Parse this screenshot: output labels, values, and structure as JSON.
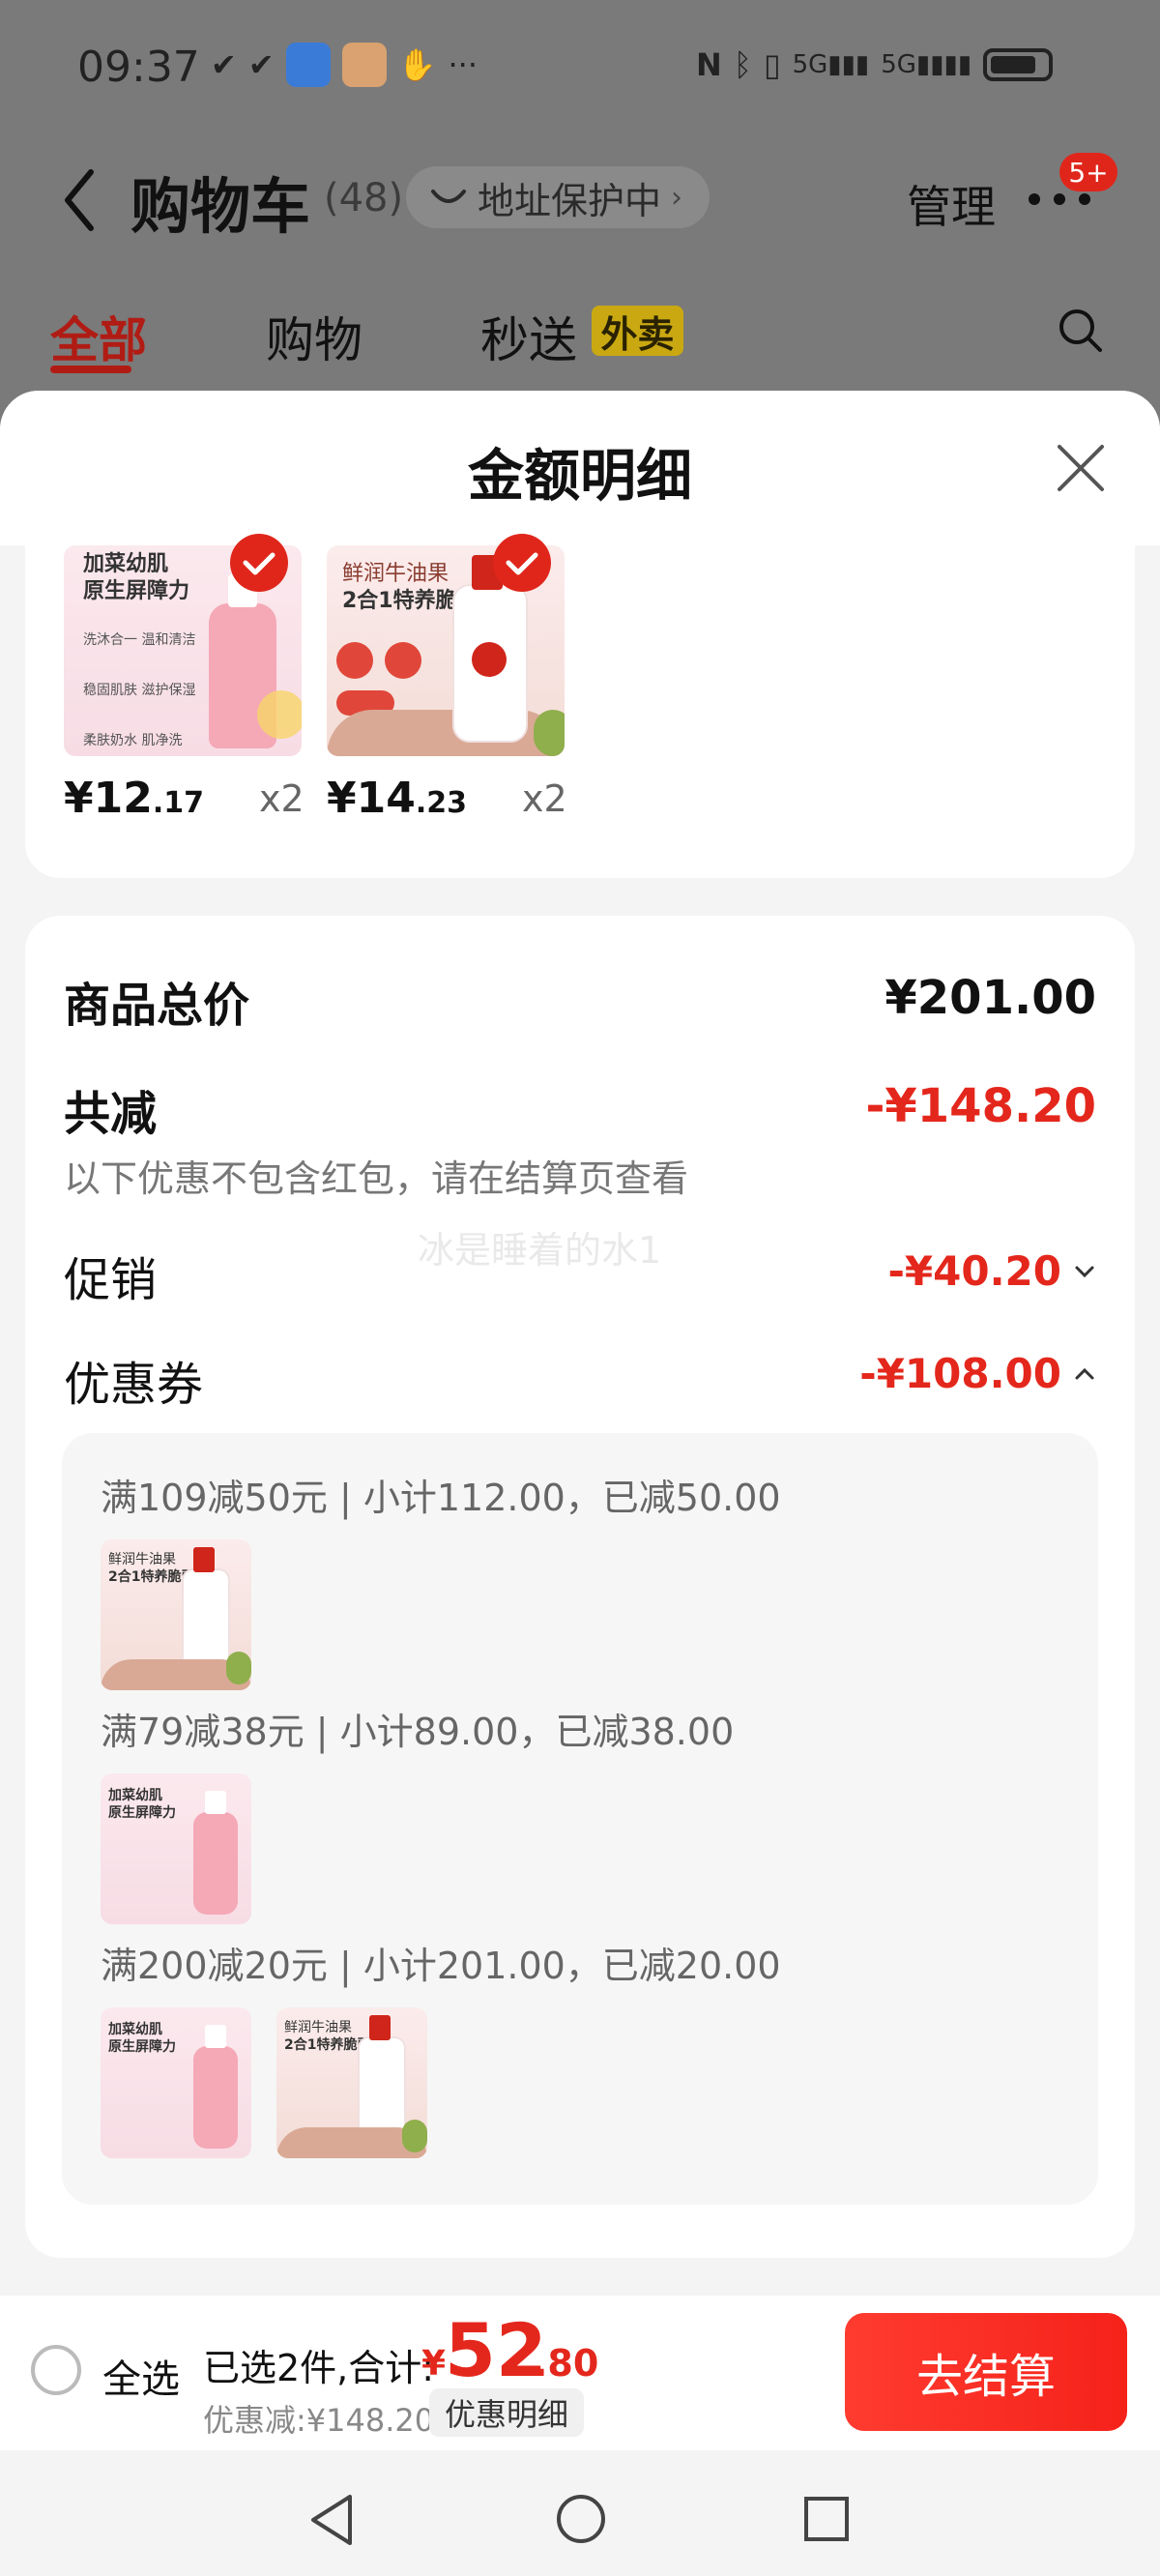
{
  "status": {
    "time": "09:37"
  },
  "header": {
    "title": "购物车",
    "count": "(48)",
    "address": "地址保护中",
    "manage": "管理",
    "more_badge": "5+"
  },
  "tabs": [
    {
      "label": "全部"
    },
    {
      "label": "购物"
    },
    {
      "label": "秒送"
    }
  ],
  "tab_badge": "外卖",
  "sheet": {
    "title": "金额明细"
  },
  "items": [
    {
      "currency": "¥",
      "price_int": "12",
      "price_dec": ".17",
      "qty": "x2",
      "thumb_lines": [
        "加菜幼肌",
        "原生屏障力",
        "洗沐合一 温和清洁",
        "稳固肌肤 滋护保湿",
        "柔肤奶水 肌净洗"
      ]
    },
    {
      "currency": "¥",
      "price_int": "14",
      "price_dec": ".23",
      "qty": "x2",
      "thumb_lines": [
        "鲜润牛油果",
        "2合1特养脆弱"
      ]
    }
  ],
  "summary": {
    "total_label": "商品总价",
    "total_value": "¥201.00",
    "reduce_label": "共减",
    "reduce_value": "-¥148.20",
    "note": "以下优惠不包含红包，请在结算页查看",
    "watermark": "冰是睡着的水1",
    "promo_label": "促销",
    "promo_value": "-¥40.20",
    "coupon_label": "优惠券",
    "coupon_value": "-¥108.00"
  },
  "coupons": [
    {
      "line": "满109减50元 | 小计112.00，已减50.00"
    },
    {
      "line": "满79减38元 | 小计89.00，已减38.00"
    },
    {
      "line": "满200减20元 | 小计201.00，已减20.00"
    }
  ],
  "bottom": {
    "select_all": "全选",
    "summary_label": "已选2件,合计:",
    "currency": "¥",
    "total_int": "52",
    "total_dec": ".80",
    "discount": "优惠减:¥148.20",
    "detail_button": "优惠明细",
    "checkout": "去结算"
  },
  "colors": {
    "accent_red": "#e4271c",
    "tab_red": "#b01c14",
    "overlay": "#7a7a7a"
  }
}
